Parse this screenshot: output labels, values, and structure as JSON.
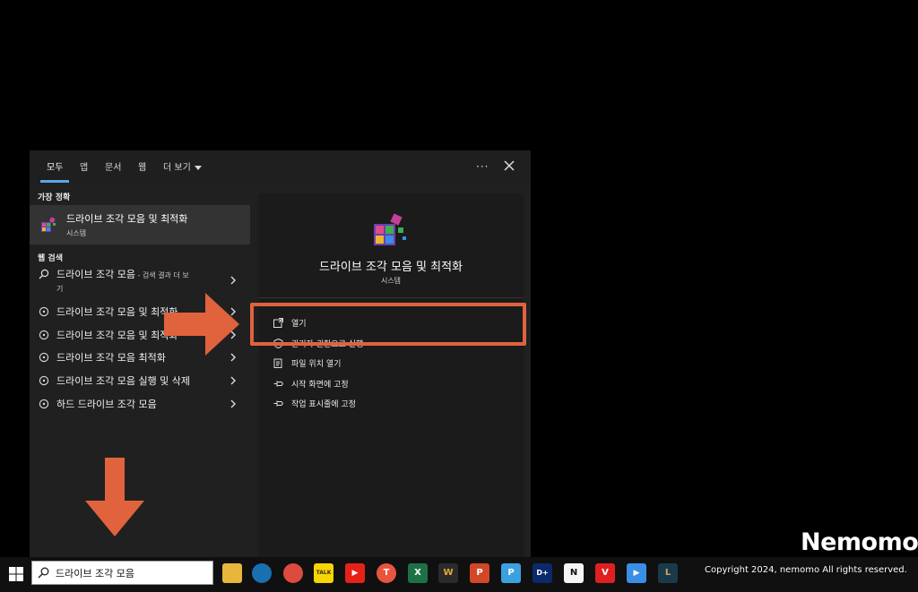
{
  "tabs": [
    {
      "label": "모두"
    },
    {
      "label": "앱"
    },
    {
      "label": "문서"
    },
    {
      "label": "웹"
    },
    {
      "label": "더 보기"
    }
  ],
  "more_label": "···",
  "best_match": {
    "section_label": "가장 정확",
    "title": "드라이브 조각 모음 및 최적화",
    "subtitle": "시스템"
  },
  "web_search": {
    "section_label": "웹 검색",
    "items": [
      {
        "text": "드라이브 조각 모음",
        "suffix": " - 검색 결과 더 보",
        "line2": "기",
        "icon": "search-icon"
      },
      {
        "text": "드라이브 조각 모음 및 최적화",
        "icon": "web-bubble-icon"
      },
      {
        "text": "드라이브 조각 모음 및 최적화",
        "icon": "web-bubble-icon"
      },
      {
        "text": "드라이브 조각 모음 최적화",
        "icon": "web-bubble-icon"
      },
      {
        "text": "드라이브 조각 모음 실행 및 삭제",
        "icon": "web-bubble-icon"
      },
      {
        "text": "하드 드라이브 조각 모음",
        "icon": "web-bubble-icon"
      }
    ]
  },
  "detail": {
    "title": "드라이브 조각 모음 및 최적화",
    "subtitle": "시스템",
    "actions": [
      {
        "label": "열기",
        "icon": "open-icon"
      },
      {
        "label": "관리자 권한으로 실행",
        "icon": "admin-icon"
      },
      {
        "label": "파일 위치 열기",
        "icon": "folder-icon"
      },
      {
        "label": "시작 화면에 고정",
        "icon": "pin-icon"
      },
      {
        "label": "작업 표시줄에 고정",
        "icon": "pin-icon"
      }
    ]
  },
  "taskbar": {
    "search_value": "드라이브 조각 모음",
    "apps": [
      {
        "name": "file-explorer",
        "glyph": "",
        "color": "#e8b63a"
      },
      {
        "name": "edge",
        "glyph": "",
        "color": "#2a8fd6"
      },
      {
        "name": "chrome",
        "glyph": "",
        "color": "#dd4b3e"
      },
      {
        "name": "kakaotalk",
        "glyph": "TALK",
        "color": "#f7d600"
      },
      {
        "name": "youtube",
        "glyph": "▶",
        "color": "#e62117"
      },
      {
        "name": "app-red-circle",
        "glyph": "T",
        "color": "#e8553e"
      },
      {
        "name": "excel",
        "glyph": "X",
        "color": "#1e7145"
      },
      {
        "name": "app-stripes",
        "glyph": "W",
        "color": "#2b2b2b"
      },
      {
        "name": "powerpoint",
        "glyph": "P",
        "color": "#d24726"
      },
      {
        "name": "app-phone",
        "glyph": "P",
        "color": "#3aa0e0"
      },
      {
        "name": "disney-plus",
        "glyph": "D+",
        "color": "#0b2a6b"
      },
      {
        "name": "notion",
        "glyph": "N",
        "color": "#f5f5f5"
      },
      {
        "name": "app-v",
        "glyph": "V",
        "color": "#e02020"
      },
      {
        "name": "play-store",
        "glyph": "▶",
        "color": "#3a8ee6"
      },
      {
        "name": "league",
        "glyph": "L",
        "color": "#1a3a4a"
      }
    ]
  },
  "watermark": "Nemomo",
  "copyright": "Copyright 2024, nemomo All rights reserved.",
  "accent_color": "#e0633d"
}
